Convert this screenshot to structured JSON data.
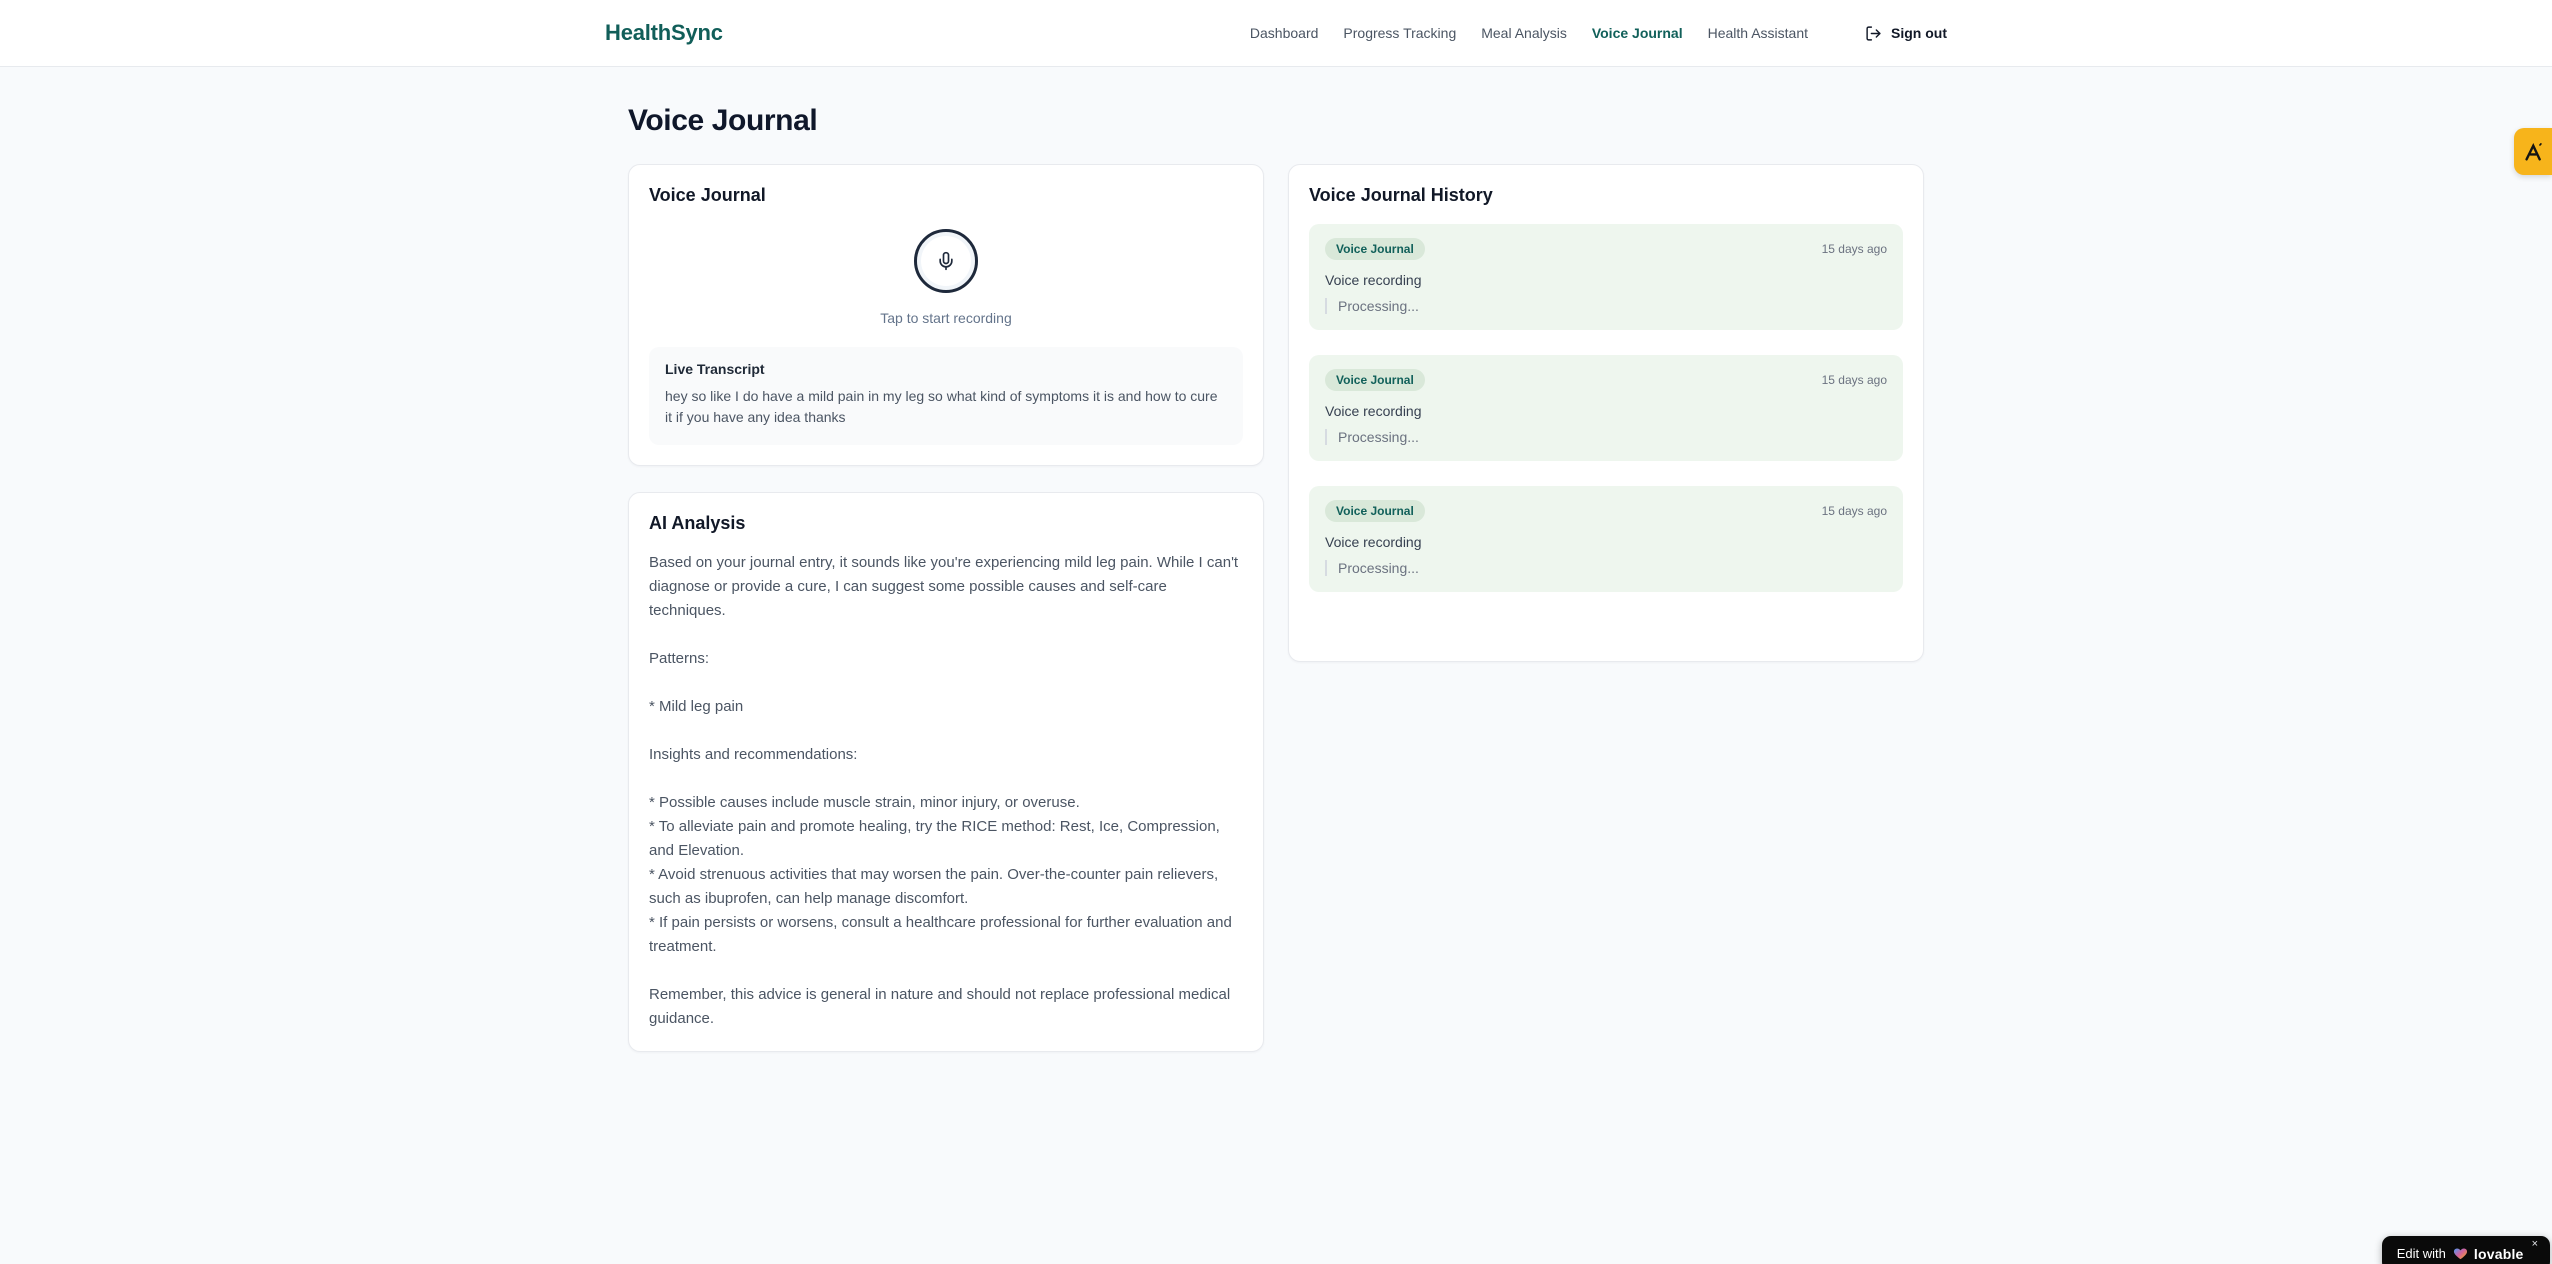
{
  "header": {
    "logo": "HealthSync",
    "nav": [
      {
        "label": "Dashboard",
        "active": false
      },
      {
        "label": "Progress Tracking",
        "active": false
      },
      {
        "label": "Meal Analysis",
        "active": false
      },
      {
        "label": "Voice Journal",
        "active": true
      },
      {
        "label": "Health Assistant",
        "active": false
      }
    ],
    "signout_label": "Sign out"
  },
  "page": {
    "title": "Voice Journal"
  },
  "recorder_card": {
    "title": "Voice Journal",
    "tap_hint": "Tap to start recording",
    "transcript_title": "Live Transcript",
    "transcript_text": "hey so like I do have a mild pain in my leg so what kind of symptoms it is and how to cure it if you have any idea thanks"
  },
  "analysis_card": {
    "title": "AI Analysis",
    "body": "Based on your journal entry, it sounds like you're experiencing mild leg pain. While I can't diagnose or provide a cure, I can suggest some possible causes and self-care techniques.\n\nPatterns:\n\n* Mild leg pain\n\nInsights and recommendations:\n\n* Possible causes include muscle strain, minor injury, or overuse.\n* To alleviate pain and promote healing, try the RICE method: Rest, Ice, Compression, and Elevation.\n* Avoid strenuous activities that may worsen the pain. Over-the-counter pain relievers, such as ibuprofen, can help manage discomfort.\n* If pain persists or worsens, consult a healthcare professional for further evaluation and treatment.\n\nRemember, this advice is general in nature and should not replace professional medical guidance."
  },
  "history_card": {
    "title": "Voice Journal History",
    "entries": [
      {
        "badge": "Voice Journal",
        "time": "15 days ago",
        "label": "Voice recording",
        "status": "Processing..."
      },
      {
        "badge": "Voice Journal",
        "time": "15 days ago",
        "label": "Voice recording",
        "status": "Processing..."
      },
      {
        "badge": "Voice Journal",
        "time": "15 days ago",
        "label": "Voice recording",
        "status": "Processing..."
      }
    ]
  },
  "widgets": {
    "lovable_prefix": "Edit with",
    "lovable_brand": "lovable",
    "lovable_close": "×",
    "side_tab_icon": "amber-a-logo-icon"
  },
  "colors": {
    "accent_teal": "#115e59",
    "page_bg": "#f8fafc",
    "entry_bg": "#eef6ee",
    "badge_bg": "#d9e8d9",
    "side_tab": "#f7b41b",
    "lovable_bg": "#0a0a0a"
  }
}
